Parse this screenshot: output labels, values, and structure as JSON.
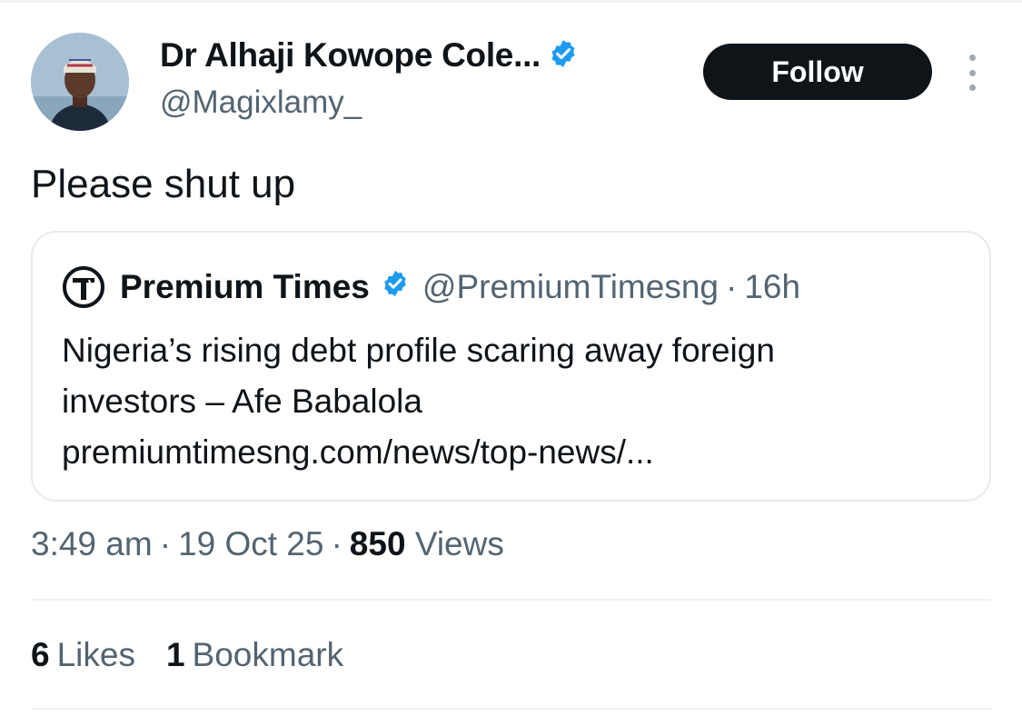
{
  "author": {
    "display_name": "Dr Alhaji Kowope Cole...",
    "handle": "@Magixlamy_",
    "verified_color": "#1d9bf0"
  },
  "actions": {
    "follow_label": "Follow",
    "more_icon": "more-vertical-icon"
  },
  "tweet": {
    "text": "Please shut up"
  },
  "quote": {
    "logo_icon": "premium-times-logo",
    "name": "Premium Times",
    "handle": "@PremiumTimesng",
    "separator": "·",
    "time": "16h",
    "line1": "Nigeria’s rising debt profile scaring away foreign",
    "line2": "investors – Afe Babalola",
    "link": "premiumtimesng.com/news/top-news/..."
  },
  "meta": {
    "time": "3:49 am",
    "separator": "·",
    "date": "19 Oct 25",
    "views_count": "850",
    "views_label": "Views"
  },
  "stats": {
    "likes_count": "6",
    "likes_label": "Likes",
    "bookmarks_count": "1",
    "bookmarks_label": "Bookmark"
  }
}
